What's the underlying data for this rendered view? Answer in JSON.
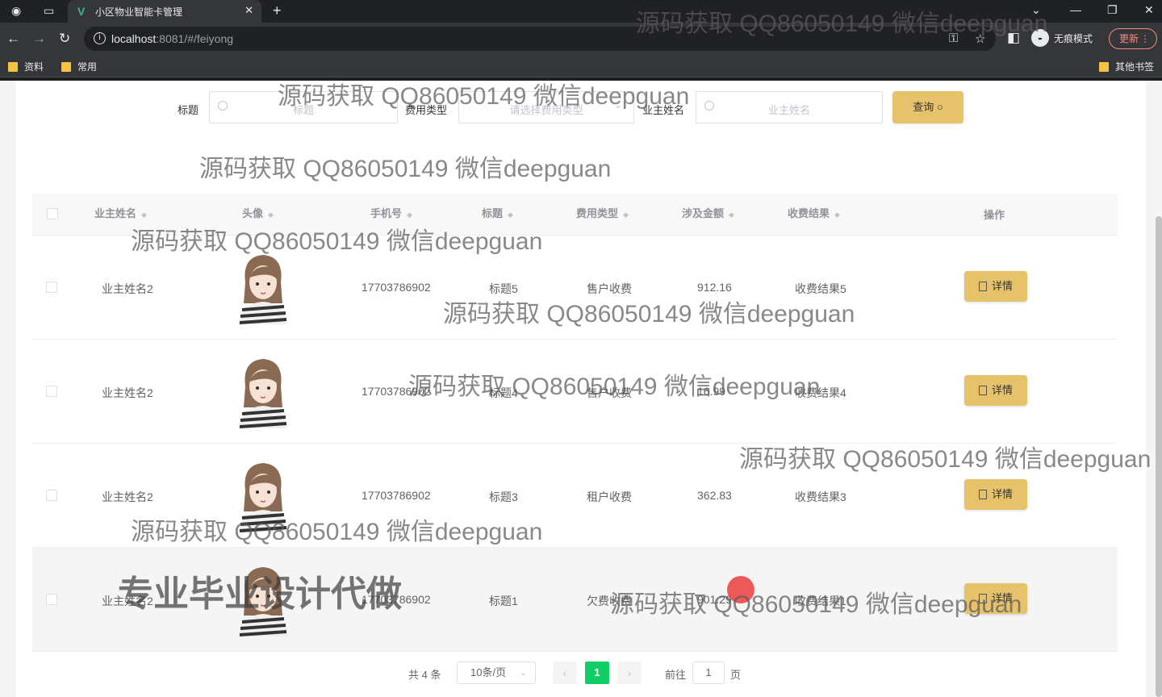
{
  "browser": {
    "tab_title": "小区物业智能卡管理",
    "url_host": "localhost",
    "url_rest": ":8081/#/feiyong",
    "incognito_label": "无痕模式",
    "update_label": "更新",
    "bookmarks": [
      "资料",
      "常用"
    ],
    "other_bookmarks": "其他书签"
  },
  "search": {
    "title_label": "标题",
    "title_placeholder": "标题",
    "fee_type_label": "费用类型",
    "fee_type_placeholder": "请选择费用类型",
    "owner_label": "业主姓名",
    "owner_placeholder": "业主姓名",
    "query_button": "查询"
  },
  "table": {
    "columns": [
      "业主姓名",
      "头像",
      "手机号",
      "标题",
      "费用类型",
      "涉及金额",
      "收费结果",
      "操作"
    ],
    "rows": [
      {
        "owner": "业主姓名2",
        "phone": "17703786902",
        "title": "标题5",
        "fee_type": "售户收费",
        "amount": "912.16",
        "result": "收费结果5",
        "action": "详情"
      },
      {
        "owner": "业主姓名2",
        "phone": "17703786902",
        "title": "标题4",
        "fee_type": "售户收费",
        "amount": "16.99",
        "result": "收费结果4",
        "action": "详情"
      },
      {
        "owner": "业主姓名2",
        "phone": "17703786902",
        "title": "标题3",
        "fee_type": "租户收费",
        "amount": "362.83",
        "result": "收费结果3",
        "action": "详情"
      },
      {
        "owner": "业主姓名2",
        "phone": "17703786902",
        "title": "标题1",
        "fee_type": "欠费收费",
        "amount": "901.29",
        "result": "收费结果1",
        "action": "详情"
      }
    ]
  },
  "pagination": {
    "total": "共 4 条",
    "page_size": "10条/页",
    "current_page": "1",
    "goto_label": "前往",
    "goto_value": "1",
    "page_suffix": "页"
  },
  "watermarks": {
    "text": "源码获取 QQ86050149 微信deepguan",
    "banner": "专业毕业设计代做"
  },
  "colors": {
    "accent_button": "#e6c36a",
    "pager_active": "#13ce66"
  }
}
